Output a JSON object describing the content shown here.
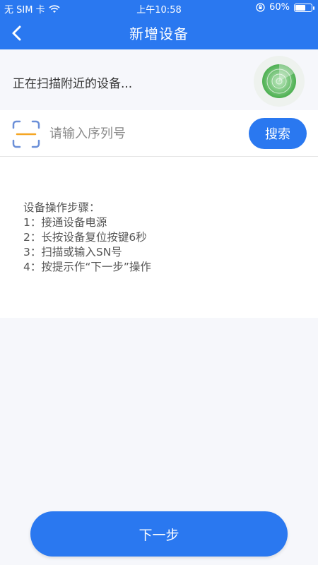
{
  "status_bar": {
    "carrier": "无 SIM 卡",
    "time": "上午10:58",
    "battery": "60%",
    "battery_level": 0.6
  },
  "navbar": {
    "title": "新增设备",
    "back_icon": "chevron-left-icon"
  },
  "scan": {
    "text": "正在扫描附近的设备...",
    "radar_icon": "radar-icon"
  },
  "search": {
    "placeholder": "请输入序列号",
    "value": "",
    "button_label": "搜索",
    "scan_icon": "qr-scan-icon"
  },
  "steps": {
    "title": "设备操作步骤：",
    "items": [
      "1：接通设备电源",
      "2：长按设备复位按键6秒",
      "3：扫描或输入SN号",
      "4：按提示作“下一步”操作"
    ]
  },
  "footer": {
    "next_label": "下一步"
  },
  "colors": {
    "primary": "#2a78f0",
    "radar_green": "#4caf50",
    "scan_accent": "#f5a623"
  }
}
